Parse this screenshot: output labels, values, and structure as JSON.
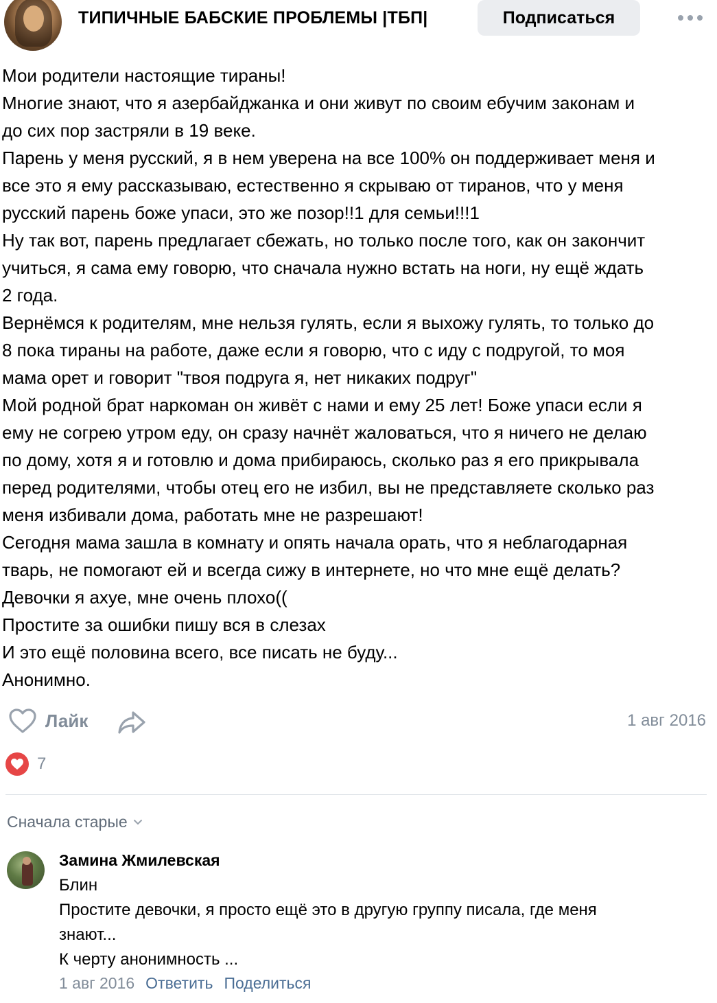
{
  "header": {
    "group_title": "ТИПИЧНЫЕ БАБСКИЕ ПРОБЛЕМЫ |ТБП|",
    "subscribe_label": "Подписаться"
  },
  "post": {
    "lines": [
      "Мои родители настоящие тираны!",
      "Многие знают, что я азербайджанка и они живут по своим ебучим законам и",
      "до сих пор застряли в 19 веке.",
      "Парень у меня русский, я в нем уверена на все 100% он поддерживает меня и",
      "все это я ему рассказываю, естественно я скрываю от тиранов, что у меня",
      "русский парень боже упаси, это же позор!!1 для семьи!!!1",
      "Ну так вот, парень предлагает сбежать, но только после того, как он закончит",
      "учиться, я сама ему говорю, что сначала нужно встать на ноги, ну ещё ждать",
      "2 года.",
      "Вернёмся к родителям, мне нельзя гулять, если я выхожу гулять, то только до",
      "8 пока тираны на работе, даже если я говорю, что с иду с подругой, то моя",
      "мама орет и говорит \"твоя подруга я, нет никаких подруг\"",
      "Мой родной брат наркоман он живёт с нами и ему 25 лет! Боже упаси если я",
      "ему не согрею утром еду, он сразу начнёт жаловаться, что я ничего не делаю",
      "по дому, хотя я и готовлю и дома прибираюсь, сколько раз я его прикрывала",
      "перед родителями, чтобы отец его не избил, вы не представляете сколько раз",
      "меня избивали дома, работать мне не разрешают!",
      "Сегодня мама зашла в комнату и опять начала орать, что я неблагодарная",
      "тварь, не помогают ей и всегда сижу в интернете, но что мне ещё делать?",
      "Девочки я ахуе, мне очень плохо((",
      "Простите за ошибки пишу вся в слезах",
      "И это ещё половина всего, все писать не буду...",
      "Анонимно."
    ],
    "like_label": "Лайк",
    "date": "1 авг 2016",
    "likes_count": "7"
  },
  "comments": {
    "sort_label": "Сначала старые",
    "items": [
      {
        "author": "Замина Жмилевская",
        "lines": [
          "Блин",
          "Простите девочки, я просто ещё это в другую группу писала, где меня",
          "знают...",
          "К черту анонимность ..."
        ],
        "date": "1 авг 2016",
        "reply_label": "Ответить",
        "share_label": "Поделиться"
      }
    ]
  },
  "icons": {
    "like": "heart-outline-icon",
    "share": "share-arrow-icon",
    "likes": "heart-filled-icon",
    "more": "more-dots-icon",
    "sort": "chevron-down-icon"
  },
  "colors": {
    "secondary_text": "#818c99",
    "link": "#4a6d94",
    "like_red": "#e64646",
    "button_bg": "#ebedf0"
  }
}
